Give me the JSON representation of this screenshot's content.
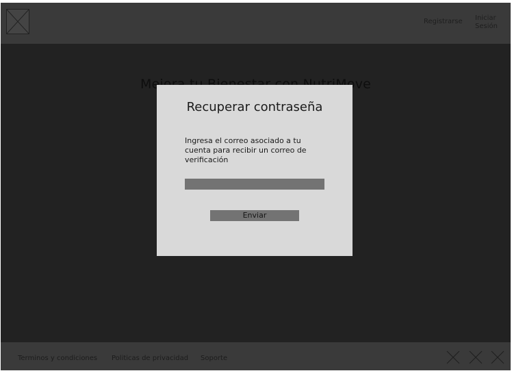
{
  "header": {
    "logo_icon": "image-placeholder-icon",
    "nav": {
      "register": "Registrarse",
      "login": "Iniciar Sesión"
    }
  },
  "hero": {
    "title": "Mejora tu Bienestar con NutriMove"
  },
  "modal": {
    "title": "Recuperar contraseña",
    "description": "Ingresa el correo asociado a tu cuenta para recibir un correo de verificación",
    "email_value": "",
    "submit_label": "Enviar"
  },
  "footer": {
    "links": [
      "Terminos y condiciones",
      "Politicas de privacidad",
      "Soporte"
    ],
    "social_icons": [
      "social-icon-1",
      "social-icon-2",
      "social-icon-3"
    ]
  },
  "colors": {
    "page_background": "#222222",
    "header_background": "#3a3a3a",
    "modal_background": "#d9d9d9",
    "control_fill": "#737373"
  }
}
